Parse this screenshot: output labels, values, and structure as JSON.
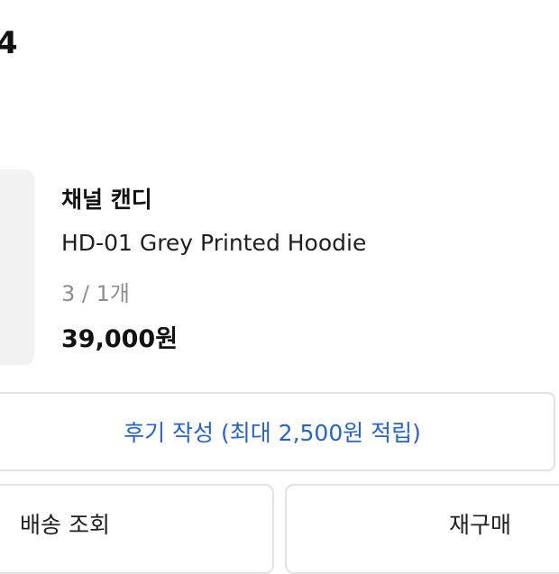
{
  "order": {
    "number_fragment": "4"
  },
  "item": {
    "brand": "채널 캔디",
    "name": "HD-01 Grey Printed Hoodie",
    "option": "3 / 1개",
    "price": "39,000원"
  },
  "actions": {
    "review_label": "후기 작성 (최대 2,500원 적립)",
    "shipping_label": "배송 조회",
    "reorder_label": "재구매"
  },
  "colors": {
    "accent": "#2463d7",
    "border": "#e2e2e2",
    "thumb_bg": "#f2f2f3",
    "muted_text": "#8e8e8e"
  }
}
